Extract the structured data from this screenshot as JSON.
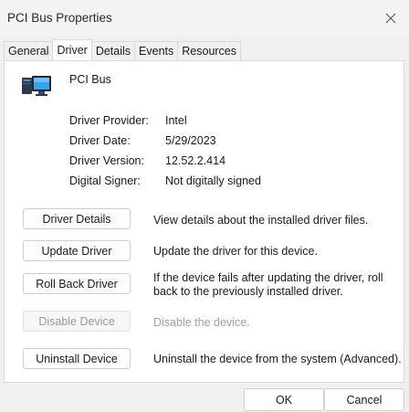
{
  "window": {
    "title": "PCI Bus Properties"
  },
  "tabs": [
    {
      "label": "General",
      "active": false
    },
    {
      "label": "Driver",
      "active": true
    },
    {
      "label": "Details",
      "active": false
    },
    {
      "label": "Events",
      "active": false
    },
    {
      "label": "Resources",
      "active": false
    }
  ],
  "device": {
    "icon": "pci-bus-device-icon",
    "name": "PCI Bus"
  },
  "properties": {
    "provider_label": "Driver Provider:",
    "provider_value": "Intel",
    "date_label": "Driver Date:",
    "date_value": "5/29/2023",
    "version_label": "Driver Version:",
    "version_value": "12.52.2.414",
    "signer_label": "Digital Signer:",
    "signer_value": "Not digitally signed"
  },
  "actions": {
    "details_label": "Driver Details",
    "details_desc": "View details about the installed driver files.",
    "update_label": "Update Driver",
    "update_desc": "Update the driver for this device.",
    "rollback_label": "Roll Back Driver",
    "rollback_desc": "If the device fails after updating the driver, roll back to the previously installed driver.",
    "disable_label": "Disable Device",
    "disable_desc": "Disable the device.",
    "uninstall_label": "Uninstall Device",
    "uninstall_desc": "Uninstall the device from the system (Advanced)."
  },
  "footer": {
    "ok_label": "OK",
    "cancel_label": "Cancel"
  }
}
